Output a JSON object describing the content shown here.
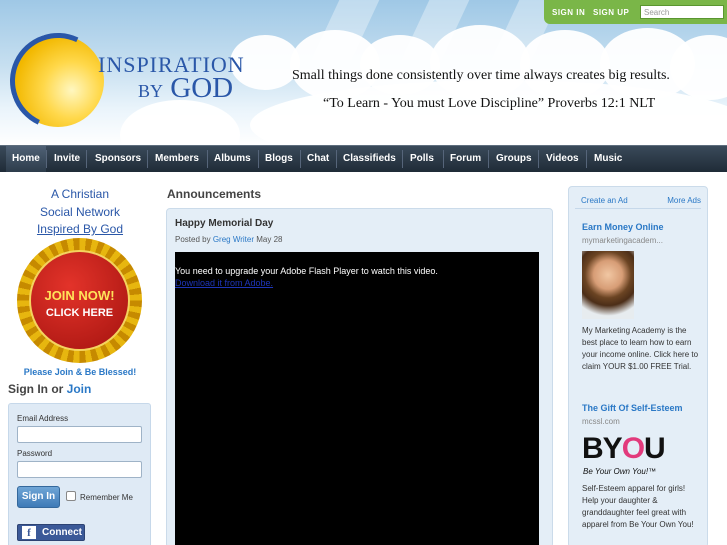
{
  "header": {
    "signin_link": "SIGN IN",
    "signup_link": "SIGN UP",
    "search_placeholder": "Search",
    "logo_line1": "INSPIRATION",
    "logo_line2_by": "BY",
    "logo_line2_god": "GOD",
    "tagline1": "Small things done consistently over time always creates big results.",
    "tagline2": "“To Learn - You must Love Discipline” Proverbs 12:1 NLT"
  },
  "nav": {
    "items": [
      "Home",
      "Invite",
      "Sponsors",
      "Members",
      "Albums",
      "Blogs",
      "Chat",
      "Classifieds",
      "Polls",
      "Forum",
      "Groups",
      "Videos",
      "Music"
    ]
  },
  "left": {
    "line1": "A Christian",
    "line2": "Social Network",
    "line3": "Inspired By God",
    "badge_line1": "JOIN NOW!",
    "badge_line2": "CLICK HERE",
    "please": "Please Join & Be Blessed!",
    "signin_text": "Sign In",
    "or_text": " or ",
    "join_text": "Join",
    "email_label": "Email Address",
    "password_label": "Password",
    "signin_button": "Sign In",
    "remember_label": "Remember Me",
    "connect_button": "Connect"
  },
  "main": {
    "heading": "Announcements",
    "post_title": "Happy Memorial Day",
    "posted_by": "Posted by ",
    "author": "Greg Writer",
    "date": " May 28",
    "flash_message": "You need to upgrade your Adobe Flash Player to watch this video.",
    "download_link": "Download it from Adobe."
  },
  "ads": {
    "create": "Create an Ad",
    "more": "More Ads",
    "ad1_title": "Earn Money Online",
    "ad1_domain": "mymarketingacadem...",
    "ad1_text": "My Marketing Academy is the best place to learn how to earn your income online. Click here to claim YOUR $1.00 FREE Trial.",
    "ad2_title": "The Gift Of Self-Esteem",
    "ad2_domain": "mcssl.com",
    "byou_b": "BY",
    "byou_heart": "O",
    "byou_u": "U",
    "byou_slogan": "Be Your Own You!™",
    "ad2_text": "Self-Esteem apparel for girls! Help your daughter & granddaughter feel great with apparel from Be Your Own You!"
  },
  "colors": {
    "brand_blue": "#2a57a8",
    "link_blue": "#2a78c6",
    "topbar_green": "#7ab648",
    "nav_dark": "#1f2b37"
  }
}
